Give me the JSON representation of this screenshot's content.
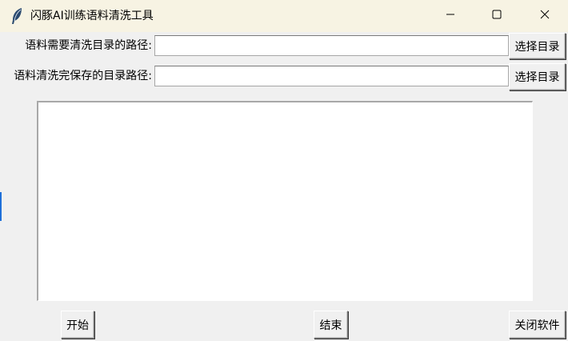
{
  "window": {
    "title": "闪豚AI训练语料清洗工具",
    "icon": "feather-icon",
    "controls": {
      "minimize": "minimize-icon",
      "maximize": "maximize-icon",
      "close": "close-icon"
    }
  },
  "form": {
    "source_dir": {
      "label": "语料需要清洗目录的路径:",
      "value": "",
      "button_label": "选择目录"
    },
    "output_dir": {
      "label": "语料清洗完保存的目录路径:",
      "value": "",
      "button_label": "选择目录"
    }
  },
  "log": {
    "content": ""
  },
  "actions": {
    "start_label": "开始",
    "stop_label": "结束",
    "close_label": "关闭软件"
  },
  "colors": {
    "window_bg": "#f0f0f0",
    "titlebar_bg": "#f7f3e3",
    "accent_edge": "#1e6fd9"
  }
}
